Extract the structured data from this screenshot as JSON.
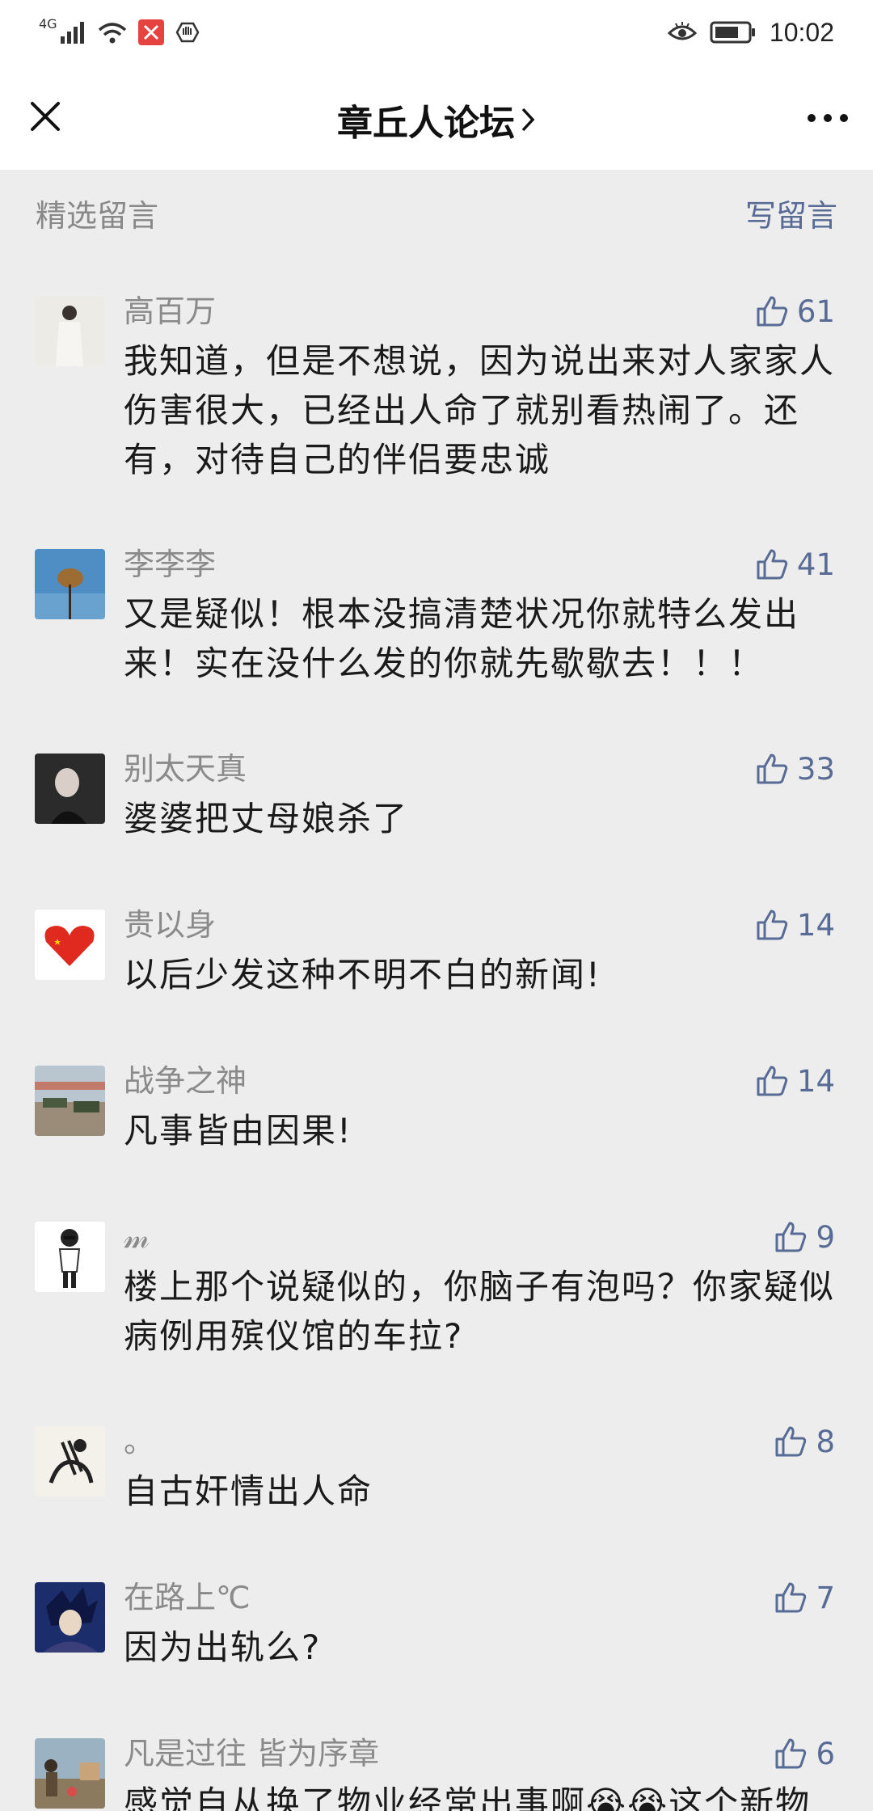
{
  "status": {
    "network": "4G",
    "time": "10:02"
  },
  "nav": {
    "title": "章丘人论坛",
    "chevron": "›",
    "close_icon": "close-icon",
    "more_icon": "more-icon"
  },
  "section": {
    "left_label": "精选留言",
    "right_label": "写留言"
  },
  "colors": {
    "accent": "#576b95",
    "background": "#ededed"
  },
  "comments": [
    {
      "name": "高百万",
      "likes": "61",
      "text": "我知道，但是不想说，因为说出来对人家家人伤害很大，已经出人命了就别看热闹了。还有，对待自己的伴侣要忠诚"
    },
    {
      "name": "李李李",
      "likes": "41",
      "text": "又是疑似！根本没搞清楚状况你就特么发出来！实在没什么发的你就先歇歇去！！！"
    },
    {
      "name": "别太天真",
      "likes": "33",
      "text": "婆婆把丈母娘杀了"
    },
    {
      "name": "贵以身",
      "likes": "14",
      "text": "以后少发这种不明不白的新闻!"
    },
    {
      "name": "战争之神",
      "likes": "14",
      "text": "凡事皆由因果!"
    },
    {
      "name": "𝓂",
      "likes": "9",
      "text": "楼上那个说疑似的，你脑子有泡吗？你家疑似病例用殡仪馆的车拉?"
    },
    {
      "name": "。",
      "likes": "8",
      "text": "自古奸情出人命"
    },
    {
      "name": "在路上℃",
      "likes": "7",
      "text": "因为出轨么?"
    },
    {
      "name": "凡是过往 皆为序章",
      "likes": "6",
      "text": "感觉自从换了物业经常出事啊😭😭这个新物"
    }
  ]
}
